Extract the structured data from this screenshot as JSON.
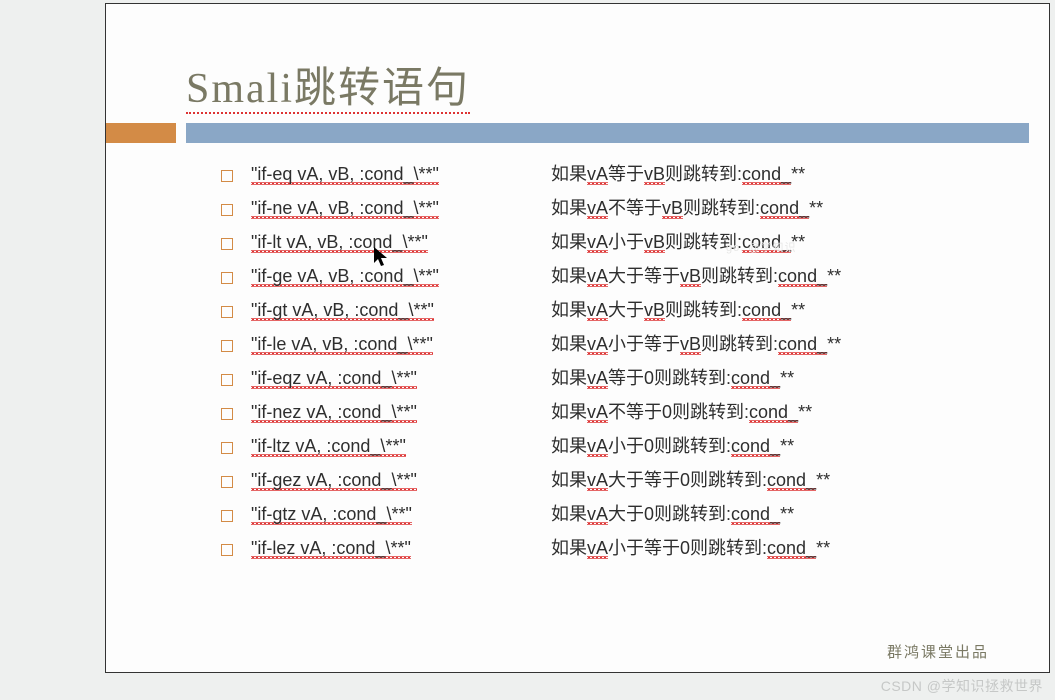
{
  "title": "Smali跳转语句",
  "items": [
    {
      "code": "\"if-eq vA, vB, :cond_\\**\"",
      "desc_pre": "如果",
      "va": "vA",
      "mid": "等于",
      "vb": "vB",
      "desc_tail": "则跳转到:",
      "cond": "cond_",
      "suffix": "**"
    },
    {
      "code": "\"if-ne vA, vB, :cond_\\**\"",
      "desc_pre": "如果",
      "va": "vA",
      "mid": "不等于",
      "vb": "vB",
      "desc_tail": "则跳转到:",
      "cond": "cond_",
      "suffix": "**"
    },
    {
      "code": "\"if-lt vA, vB, :cond_\\**\"",
      "desc_pre": "如果",
      "va": "vA",
      "mid": "小于",
      "vb": "vB",
      "desc_tail": "则跳转到:",
      "cond": "cond_",
      "suffix": "**"
    },
    {
      "code": "\"if-ge vA, vB, :cond_\\**\"",
      "desc_pre": "如果",
      "va": "vA",
      "mid": "大于等于",
      "vb": "vB",
      "desc_tail": "则跳转到:",
      "cond": "cond_",
      "suffix": "**"
    },
    {
      "code": "\"if-gt vA, vB, :cond_\\**\"",
      "desc_pre": "如果",
      "va": "vA",
      "mid": "大于",
      "vb": "vB",
      "desc_tail": "则跳转到:",
      "cond": "cond_",
      "suffix": "**"
    },
    {
      "code": "\"if-le vA, vB, :cond_\\**\"",
      "desc_pre": "如果",
      "va": "vA",
      "mid": "小于等于",
      "vb": "vB",
      "desc_tail": "则跳转到:",
      "cond": "cond_",
      "suffix": "**"
    },
    {
      "code": "\"if-eqz vA, :cond_\\**\"",
      "desc_pre": "如果",
      "va": "vA",
      "mid": "等于0则跳转到:",
      "vb": "",
      "desc_tail": "",
      "cond": "cond_",
      "suffix": "**"
    },
    {
      "code": "\"if-nez vA, :cond_\\**\"",
      "desc_pre": "如果",
      "va": "vA",
      "mid": "不等于0则跳转到:",
      "vb": "",
      "desc_tail": "",
      "cond": "cond_",
      "suffix": "**"
    },
    {
      "code": "\"if-ltz vA, :cond_\\**\"",
      "desc_pre": "如果",
      "va": "vA",
      "mid": "小于0则跳转到:",
      "vb": "",
      "desc_tail": "",
      "cond": "cond_",
      "suffix": "**"
    },
    {
      "code": "\"if-gez vA, :cond_\\**\"",
      "desc_pre": "如果",
      "va": "vA",
      "mid": "大于等于0则跳转到:",
      "vb": "",
      "desc_tail": "",
      "cond": "cond_",
      "suffix": "**"
    },
    {
      "code": "\"if-gtz vA, :cond_\\**\"",
      "desc_pre": "如果",
      "va": "vA",
      "mid": "大于0则跳转到:",
      "vb": "",
      "desc_tail": "",
      "cond": "cond_",
      "suffix": "**"
    },
    {
      "code": "\"if-lez vA, :cond_\\**\"",
      "desc_pre": "如果",
      "va": "vA",
      "mid": "小于等于0则跳转到:",
      "vb": "",
      "desc_tail": "",
      "cond": "cond_",
      "suffix": "**"
    }
  ],
  "credit": "群鸿课堂出品",
  "watermark": "CSDN @学知识拯救世界"
}
